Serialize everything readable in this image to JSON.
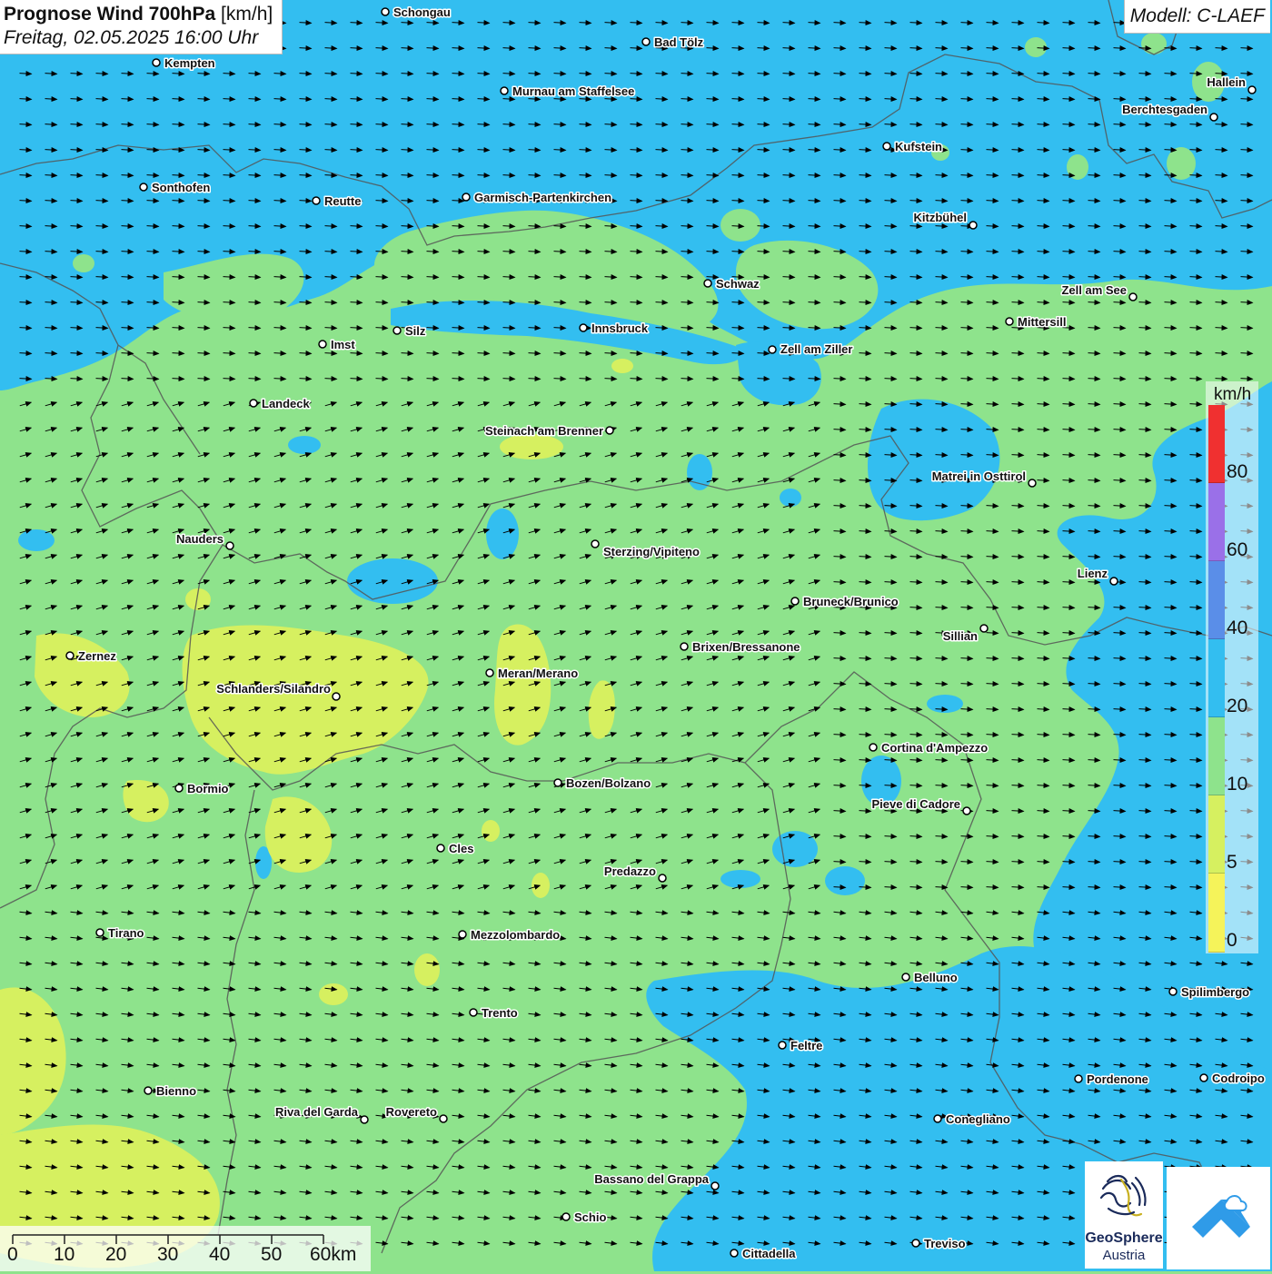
{
  "header": {
    "title_bold": "Prognose Wind 700hPa",
    "title_unit": "[km/h]",
    "subtitle": "Freitag, 02.05.2025 16:00 Uhr",
    "model": "Modell: C-LAEF"
  },
  "legend": {
    "unit": "km/h",
    "ticks": [
      "80",
      "60",
      "40",
      "20",
      "10",
      "5",
      "0"
    ],
    "colors": [
      "#f03030",
      "#9a70e8",
      "#5a8ee8",
      "#33bef0",
      "#8ee38c",
      "#d6f060",
      "#f5f35a"
    ]
  },
  "scalebar": {
    "labels": [
      "0",
      "10",
      "20",
      "30",
      "40",
      "50",
      "60km"
    ]
  },
  "logos": {
    "geosphere_line1": "GeoSphere",
    "geosphere_line2": "Austria"
  },
  "colors": {
    "calm": "#f5f35a",
    "light": "#d6f060",
    "moderate": "#8ee38c",
    "fresh": "#33bef0",
    "strong": "#5a8ee8",
    "border": "#555555",
    "logo_blue": "#2f9be8"
  },
  "wind": {
    "direction": "west to east (slightly south-west)"
  },
  "cities": [
    {
      "name": "Schongau"
    },
    {
      "name": "Bad Tölz"
    },
    {
      "name": "Kempten"
    },
    {
      "name": "Murnau am Staffelsee"
    },
    {
      "name": "Hallein"
    },
    {
      "name": "Berchtesgaden"
    },
    {
      "name": "Kufstein"
    },
    {
      "name": "Sonthofen"
    },
    {
      "name": "Reutte"
    },
    {
      "name": "Garmisch-Partenkirchen"
    },
    {
      "name": "Kitzbühel"
    },
    {
      "name": "Schwaz"
    },
    {
      "name": "Zell am See"
    },
    {
      "name": "Mittersill"
    },
    {
      "name": "Silz"
    },
    {
      "name": "Innsbruck"
    },
    {
      "name": "Imst"
    },
    {
      "name": "Zell am Ziller"
    },
    {
      "name": "Landeck"
    },
    {
      "name": "Steinach am Brenner"
    },
    {
      "name": "Matrei in Osttirol"
    },
    {
      "name": "Nauders"
    },
    {
      "name": "Sterzing/Vipiteno"
    },
    {
      "name": "Lienz"
    },
    {
      "name": "Bruneck/Brunico"
    },
    {
      "name": "Sillian"
    },
    {
      "name": "Zernez"
    },
    {
      "name": "Brixen/Bressanone"
    },
    {
      "name": "Meran/Merano"
    },
    {
      "name": "Schlanders/Silandro"
    },
    {
      "name": "Cortina d'Ampezzo"
    },
    {
      "name": "Bozen/Bolzano"
    },
    {
      "name": "Bormio"
    },
    {
      "name": "Pieve di Cadore"
    },
    {
      "name": "Cles"
    },
    {
      "name": "Predazzo"
    },
    {
      "name": "Tirano"
    },
    {
      "name": "Mezzolombardo"
    },
    {
      "name": "Belluno"
    },
    {
      "name": "Spilimbergo"
    },
    {
      "name": "Trento"
    },
    {
      "name": "Feltre"
    },
    {
      "name": "Pordenone"
    },
    {
      "name": "Codroipo"
    },
    {
      "name": "Bienno"
    },
    {
      "name": "Riva del Garda"
    },
    {
      "name": "Rovereto"
    },
    {
      "name": "Conegliano"
    },
    {
      "name": "Bassano del Grappa"
    },
    {
      "name": "Schio"
    },
    {
      "name": "Treviso"
    },
    {
      "name": "Cittadella"
    }
  ]
}
